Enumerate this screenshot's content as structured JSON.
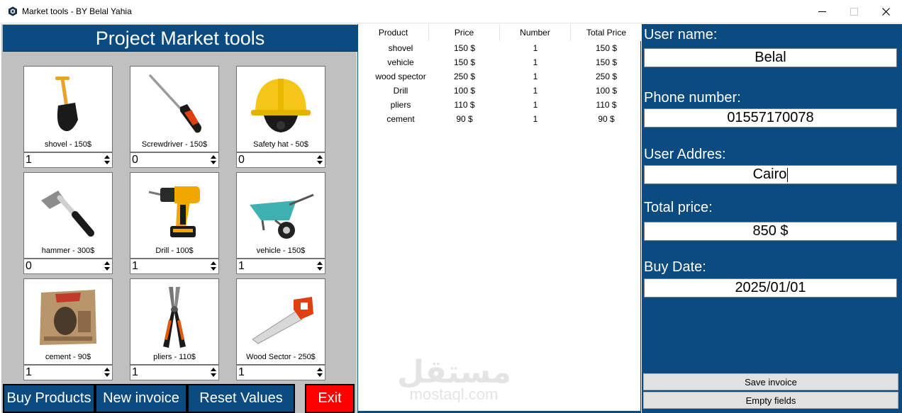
{
  "window": {
    "title": "Market tools - BY Belal Yahia"
  },
  "left": {
    "title": "Project Market tools",
    "products": [
      {
        "caption": "shovel - 150$",
        "qty": "1",
        "icon": "shovel-icon"
      },
      {
        "caption": "Screwdriver - 150$",
        "qty": "0",
        "icon": "screwdriver-icon"
      },
      {
        "caption": "Safety hat - 50$",
        "qty": "0",
        "icon": "safety-hat-icon"
      },
      {
        "caption": "hammer - 300$",
        "qty": "0",
        "icon": "hammer-icon"
      },
      {
        "caption": "Drill - 100$",
        "qty": "1",
        "icon": "drill-icon"
      },
      {
        "caption": "vehicle - 150$",
        "qty": "1",
        "icon": "wheelbarrow-icon"
      },
      {
        "caption": "cement - 90$",
        "qty": "1",
        "icon": "cement-bag-icon"
      },
      {
        "caption": "pliers - 110$",
        "qty": "1",
        "icon": "pliers-icon"
      },
      {
        "caption": "Wood Sector - 250$",
        "qty": "1",
        "icon": "saw-icon"
      }
    ],
    "buttons": {
      "buy": "Buy Products",
      "new_invoice": "New invoice",
      "reset": "Reset Values",
      "exit": "Exit"
    }
  },
  "table": {
    "columns": [
      "Product",
      "Price",
      "Number",
      "Total Price"
    ],
    "rows": [
      [
        "shovel",
        "150 $",
        "1",
        "150 $"
      ],
      [
        "vehicle",
        "150 $",
        "1",
        "150 $"
      ],
      [
        "wood spector",
        "250 $",
        "1",
        "250 $"
      ],
      [
        "Drill",
        "100 $",
        "1",
        "100 $"
      ],
      [
        "pliers",
        "110 $",
        "1",
        "110 $"
      ],
      [
        "cement",
        "90 $",
        "1",
        "90 $"
      ]
    ]
  },
  "watermark": {
    "arabic": "مستقل",
    "latin": "mostaql.com"
  },
  "right": {
    "user_name_label": "User name:",
    "user_name": "Belal",
    "phone_label": "Phone number:",
    "phone": "01557170078",
    "address_label": "User Addres:",
    "address": "Cairo",
    "total_label": "Total price:",
    "total": "850 $",
    "date_label": "Buy Date:",
    "date": "2025/01/01",
    "save_button": "Save invoice",
    "empty_button": "Empty fields"
  },
  "colors": {
    "panel_blue": "#0b4b80",
    "exit_red": "#ff0000",
    "panel_gray": "#c0c0c0"
  }
}
